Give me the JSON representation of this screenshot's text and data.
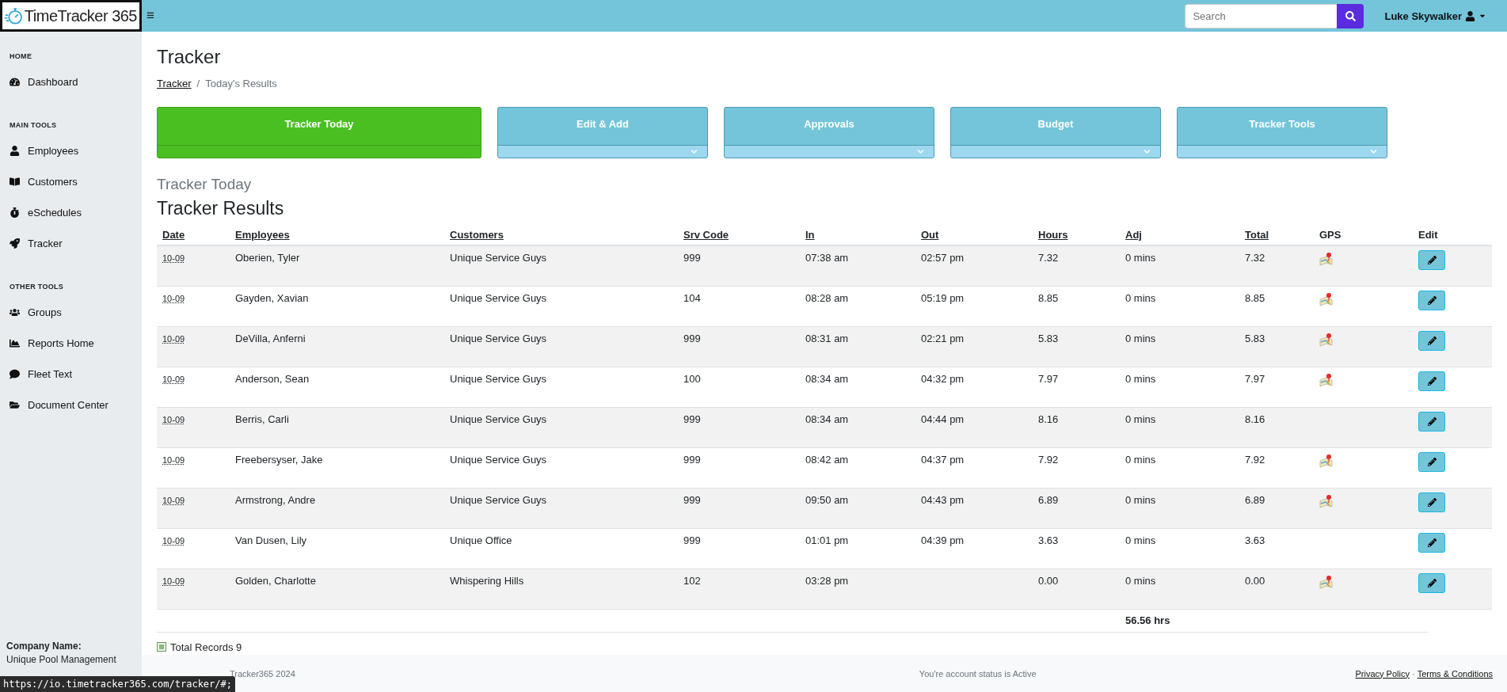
{
  "header": {
    "logo": "TimeTracker 365",
    "menu_glyph": "≡",
    "search": {
      "placeholder": "Search"
    },
    "user": "Luke Skywalker"
  },
  "sidebar": {
    "sections": [
      {
        "title": "HOME",
        "items": [
          {
            "label": "Dashboard"
          }
        ]
      },
      {
        "title": "MAIN TOOLS",
        "items": [
          {
            "label": "Employees"
          },
          {
            "label": "Customers"
          },
          {
            "label": "eSchedules"
          },
          {
            "label": "Tracker"
          }
        ]
      },
      {
        "title": "OTHER TOOLS",
        "items": [
          {
            "label": "Groups"
          },
          {
            "label": "Reports Home"
          },
          {
            "label": "Fleet Text"
          },
          {
            "label": "Document Center"
          }
        ]
      }
    ],
    "company_label": "Company Name:",
    "company": "Unique Pool Management"
  },
  "page": {
    "title": "Tracker",
    "breadcrumb": [
      {
        "label": "Tracker",
        "link": true
      },
      {
        "label": "Today's Results",
        "link": false
      }
    ],
    "breadcrumb_separator": "/"
  },
  "cards": [
    {
      "label": "Tracker Today",
      "selected": true
    },
    {
      "label": "Edit & Add",
      "selected": false
    },
    {
      "label": "Approvals",
      "selected": false
    },
    {
      "label": "Budget",
      "selected": false
    },
    {
      "label": "Tracker Tools",
      "selected": false
    }
  ],
  "section_title": "Tracker Today",
  "table": {
    "title": "Tracker Results",
    "columns": [
      {
        "label": "Date",
        "sortable": true
      },
      {
        "label": "Employees",
        "sortable": true
      },
      {
        "label": "Customers",
        "sortable": true
      },
      {
        "label": "Srv Code",
        "sortable": true
      },
      {
        "label": "In",
        "sortable": true
      },
      {
        "label": "Out",
        "sortable": true
      },
      {
        "label": "Hours",
        "sortable": true
      },
      {
        "label": "Adj",
        "sortable": true
      },
      {
        "label": "Total",
        "sortable": true
      },
      {
        "label": "GPS",
        "sortable": false
      },
      {
        "label": "Edit",
        "sortable": false
      }
    ],
    "rows": [
      {
        "date": "10-09",
        "employee": "Oberien, Tyler",
        "customer": "Unique Service Guys",
        "code": "999",
        "in": "07:38 am",
        "out": "02:57 pm",
        "hours": "7.32",
        "adj": "0 mins",
        "total": "7.32",
        "gps": true
      },
      {
        "date": "10-09",
        "employee": "Gayden, Xavian",
        "customer": "Unique Service Guys",
        "code": "104",
        "in": "08:28 am",
        "out": "05:19 pm",
        "hours": "8.85",
        "adj": "0 mins",
        "total": "8.85",
        "gps": true
      },
      {
        "date": "10-09",
        "employee": "DeVilla, Anferni",
        "customer": "Unique Service Guys",
        "code": "999",
        "in": "08:31 am",
        "out": "02:21 pm",
        "hours": "5.83",
        "adj": "0 mins",
        "total": "5.83",
        "gps": true
      },
      {
        "date": "10-09",
        "employee": "Anderson, Sean",
        "customer": "Unique Service Guys",
        "code": "100",
        "in": "08:34 am",
        "out": "04:32 pm",
        "hours": "7.97",
        "adj": "0 mins",
        "total": "7.97",
        "gps": true
      },
      {
        "date": "10-09",
        "employee": "Berris, Carli",
        "customer": "Unique Service Guys",
        "code": "999",
        "in": "08:34 am",
        "out": "04:44 pm",
        "hours": "8.16",
        "adj": "0 mins",
        "total": "8.16",
        "gps": false
      },
      {
        "date": "10-09",
        "employee": "Freebersyser, Jake",
        "customer": "Unique Service Guys",
        "code": "999",
        "in": "08:42 am",
        "out": "04:37 pm",
        "hours": "7.92",
        "adj": "0 mins",
        "total": "7.92",
        "gps": true
      },
      {
        "date": "10-09",
        "employee": "Armstrong, Andre",
        "customer": "Unique Service Guys",
        "code": "999",
        "in": "09:50 am",
        "out": "04:43 pm",
        "hours": "6.89",
        "adj": "0 mins",
        "total": "6.89",
        "gps": true
      },
      {
        "date": "10-09",
        "employee": "Van Dusen, Lily",
        "customer": "Unique Office",
        "code": "999",
        "in": "01:01 pm",
        "out": "04:39 pm",
        "hours": "3.63",
        "adj": "0 mins",
        "total": "3.63",
        "gps": false
      },
      {
        "date": "10-09",
        "employee": "Golden, Charlotte",
        "customer": "Whispering Hills",
        "code": "102",
        "in": "03:28 pm",
        "out": "",
        "hours": "0.00",
        "adj": "0 mins",
        "total": "0.00",
        "gps": true
      }
    ],
    "grand_total": "56.56 hrs",
    "records": "Total Records 9"
  },
  "footer": {
    "copyright": "Tracker365 2024",
    "status": "You're account status is Active",
    "links": [
      "Privacy Policy",
      "Terms & Conditions"
    ],
    "separator": "·"
  },
  "status_url": "https://io.timetracker365.com/tracker/#;"
}
